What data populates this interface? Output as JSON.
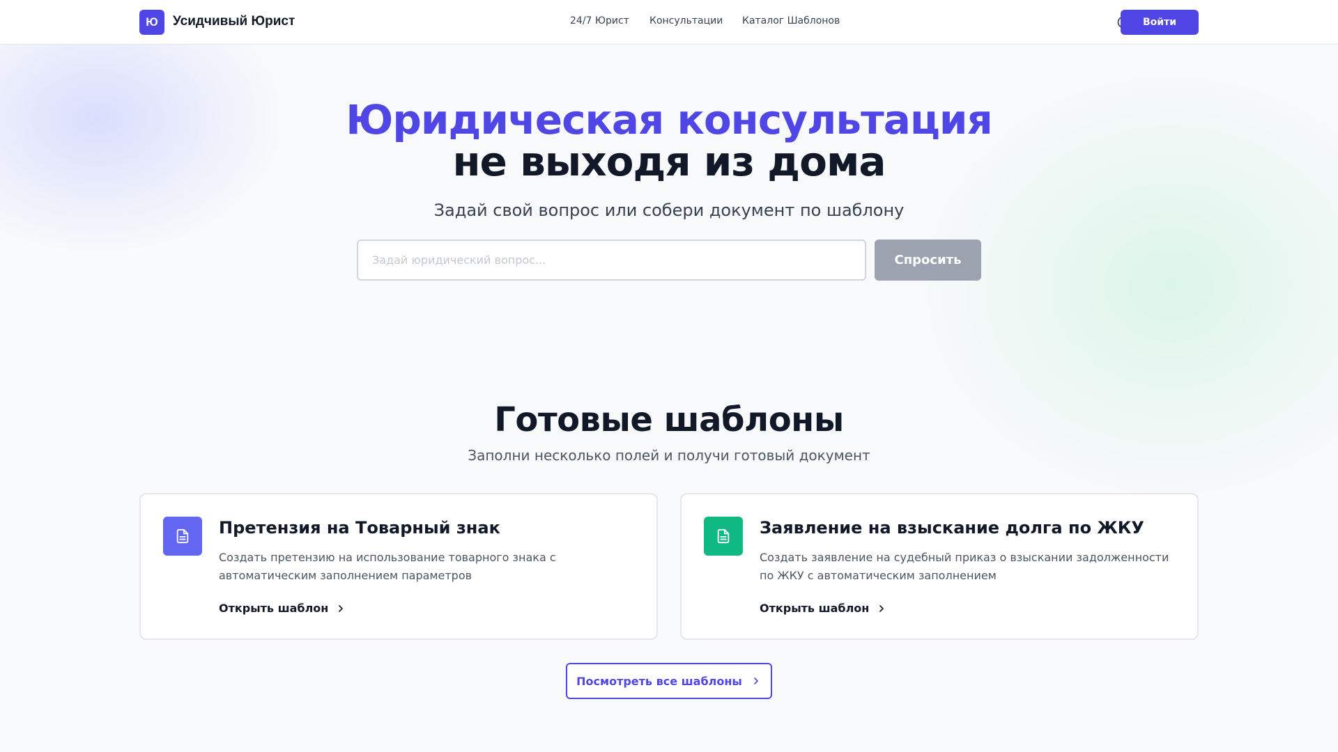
{
  "header": {
    "logo_letter": "Ю",
    "brand": "Усидчивый Юрист",
    "nav": [
      {
        "label": "24/7 Юрист"
      },
      {
        "label": "Консультации"
      },
      {
        "label": "Каталог Шаблонов"
      }
    ],
    "theme_icon": "moon-icon",
    "login_label": "Войти"
  },
  "hero": {
    "title_accent": "Юридическая консультация",
    "title_dark": "не выходя из дома",
    "subtitle": "Задай свой вопрос или собери документ по шаблону",
    "search_placeholder": "Задай юридический вопрос...",
    "search_value": "",
    "ask_label": "Спросить"
  },
  "templates": {
    "title": "Готовые шаблоны",
    "subtitle": "Заполни несколько полей и получи готовый документ",
    "cards": [
      {
        "icon": "document-icon",
        "icon_color": "#6366f1",
        "title": "Претензия на Товарный знак",
        "description": "Создать претензию на использование товарного знака с автоматическим заполнением параметров",
        "link_label": "Открыть шаблон"
      },
      {
        "icon": "document-icon",
        "icon_color": "#10b981",
        "title": "Заявление на взыскание долга по ЖКУ",
        "description": "Создать заявление на судебный приказ о взыскании задолженности по ЖКУ с автоматическим заполнением",
        "link_label": "Открыть шаблон"
      }
    ],
    "all_label": "Посмотреть все шаблоны"
  },
  "colors": {
    "accent": "#4f46e5",
    "disabled_button": "#9ca3af",
    "text_dark": "#111827"
  }
}
